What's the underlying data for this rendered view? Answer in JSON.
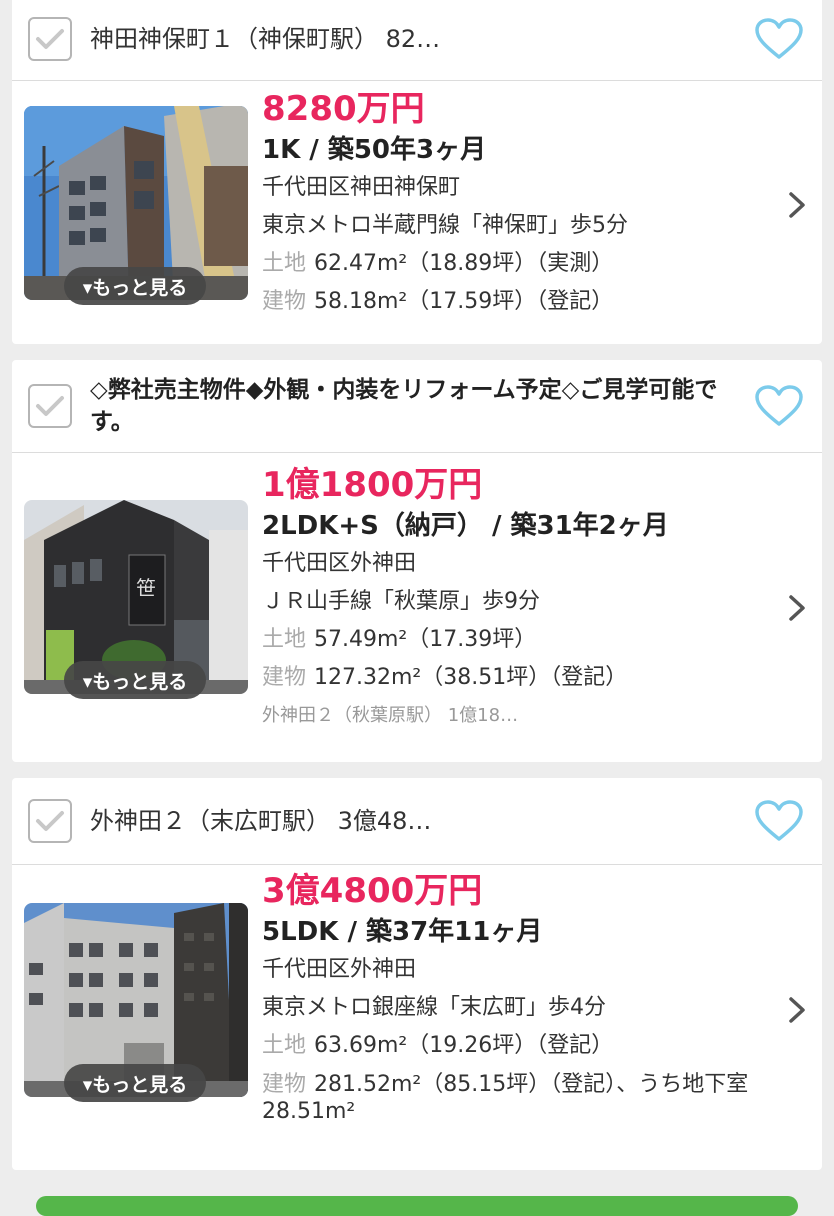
{
  "colors": {
    "price": "#e8265e",
    "heart": "#7ccbeb",
    "checkbox": "#b5b5b5",
    "more_button_bg": "#464646"
  },
  "listings": [
    {
      "title": "神田神保町１（神保町駅） 82…",
      "price": "8280万円",
      "layout": "1K / 築50年3ヶ月",
      "address": "千代田区神田神保町",
      "station": "東京メトロ半蔵門線「神保町」歩5分",
      "land_label": "土地",
      "land": "62.47m²（18.89坪）（実測）",
      "building_label": "建物",
      "building": "58.18m²（17.59坪）（登記）",
      "more": "▾もっと見る"
    },
    {
      "title": "◇弊社売主物件◆外観・内装をリフォーム予定◇ご見学可能です。",
      "price": "1億1800万円",
      "layout": "2LDK+S（納戸） / 築31年2ヶ月",
      "address": "千代田区外神田",
      "station": "ＪＲ山手線「秋葉原」歩9分",
      "land_label": "土地",
      "land": "57.49m²（17.39坪）",
      "building_label": "建物",
      "building": "127.32m²（38.51坪）（登記）",
      "sub": "外神田２（秋葉原駅） 1億18…",
      "more": "▾もっと見る"
    },
    {
      "title": "外神田２（末広町駅） 3億48…",
      "price": "3億4800万円",
      "layout": "5LDK / 築37年11ヶ月",
      "address": "千代田区外神田",
      "station": "東京メトロ銀座線「末広町」歩4分",
      "land_label": "土地",
      "land": "63.69m²（19.26坪）（登記）",
      "building_label": "建物",
      "building": "281.52m²（85.15坪）（登記）、うち地下室28.51m²",
      "more": "▾もっと見る"
    }
  ]
}
